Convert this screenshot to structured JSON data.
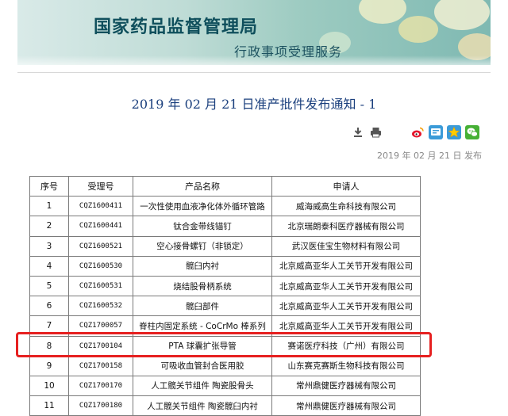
{
  "header": {
    "site_name": "国家药品监督管理局",
    "site_subtitle": "行政事项受理服务"
  },
  "article": {
    "title": "2019 年 02 月 21 日准产批件发布通知 - 1",
    "publish_date": "2019 年 02 月 21 日 发布"
  },
  "toolbar": {
    "icons": [
      "download-icon",
      "print-icon",
      "weibo-icon",
      "qq-zone-icon",
      "favorite-star-icon",
      "wechat-icon"
    ],
    "colors": {
      "weibo": "#e6162d",
      "qzone": "#3b9bd8",
      "star_bg": "#3b9bd8",
      "star": "#ffcc00",
      "wechat": "#46b035"
    }
  },
  "table": {
    "headers": [
      "序号",
      "受理号",
      "产品名称",
      "申请人"
    ],
    "rows": [
      [
        "1",
        "CQZ1600411",
        "一次性使用血液净化体外循环管路",
        "威海威高生命科技有限公司"
      ],
      [
        "2",
        "CQZ1600441",
        "钛合金带线锚钉",
        "北京瑞朗泰科医疗器械有限公司"
      ],
      [
        "3",
        "CQZ1600521",
        "空心接骨螺钉（非锁定）",
        "武汉医佳宝生物材料有限公司"
      ],
      [
        "4",
        "CQZ1600530",
        "髋臼内衬",
        "北京威高亚华人工关节开发有限公司"
      ],
      [
        "5",
        "CQZ1600531",
        "烧结股骨柄系统",
        "北京威高亚华人工关节开发有限公司"
      ],
      [
        "6",
        "CQZ1600532",
        "髋臼部件",
        "北京威高亚华人工关节开发有限公司"
      ],
      [
        "7",
        "CQZ1700057",
        "脊柱内固定系统 - CoCrMo 棒系列",
        "北京威高亚华人工关节开发有限公司"
      ],
      [
        "8",
        "CQZ1700104",
        "PTA 球囊扩张导管",
        "赛诺医疗科技（广州）有限公司"
      ],
      [
        "9",
        "CQZ1700158",
        "可吸收血管封合医用胶",
        "山东赛克赛斯生物科技有限公司"
      ],
      [
        "10",
        "CQZ1700170",
        "人工髋关节组件 陶瓷股骨头",
        "常州鼎健医疗器械有限公司"
      ],
      [
        "11",
        "CQZ1700180",
        "人工髋关节组件 陶瓷髋臼内衬",
        "常州鼎健医疗器械有限公司"
      ]
    ]
  },
  "highlight": {
    "color": "#e62020"
  }
}
